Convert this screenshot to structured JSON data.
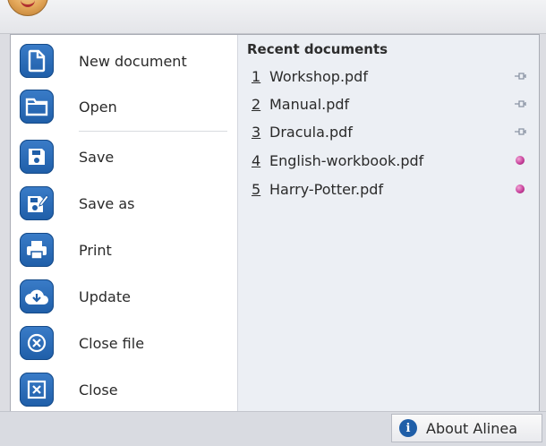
{
  "menu": {
    "commands": [
      {
        "label": "New document",
        "icon": "new-document-icon"
      },
      {
        "label": "Open",
        "icon": "folder-icon"
      },
      {
        "label": "Save",
        "icon": "floppy-disk-icon"
      },
      {
        "label": "Save as",
        "icon": "save-as-icon"
      },
      {
        "label": "Print",
        "icon": "printer-icon"
      },
      {
        "label": "Update",
        "icon": "cloud-download-icon"
      },
      {
        "label": "Close file",
        "icon": "close-circle-icon"
      },
      {
        "label": "Close",
        "icon": "close-box-icon"
      }
    ]
  },
  "recent": {
    "title": "Recent documents",
    "items": [
      {
        "number": "1",
        "name": "Workshop.pdf",
        "pinned": false
      },
      {
        "number": "2",
        "name": "Manual.pdf",
        "pinned": false
      },
      {
        "number": "3",
        "name": "Dracula.pdf",
        "pinned": false
      },
      {
        "number": "4",
        "name": "English-workbook.pdf",
        "pinned": true
      },
      {
        "number": "5",
        "name": "Harry-Potter.pdf",
        "pinned": true
      }
    ]
  },
  "footer": {
    "about_label": "About Alinea"
  },
  "colors": {
    "tile_blue": "#1f5ea8",
    "pinned_pink": "#c43a97",
    "recent_bg": "#eceff4"
  }
}
